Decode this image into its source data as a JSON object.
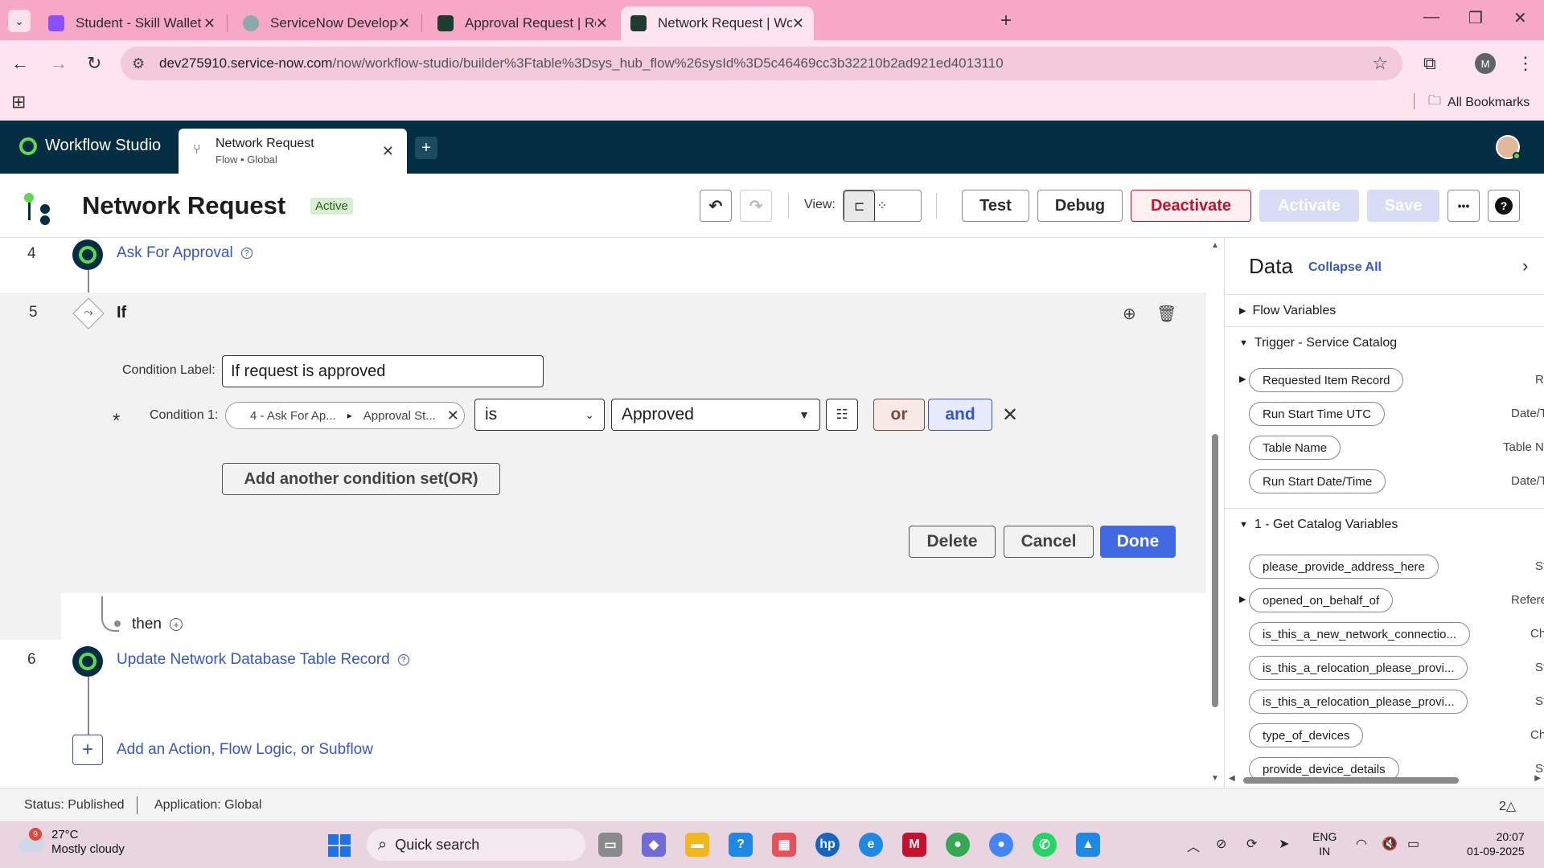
{
  "browser": {
    "tabs": [
      {
        "title": "Student - Skill Wallet",
        "color": "#8a4fff"
      },
      {
        "title": "ServiceNow Developers",
        "color": "#8aa9a8"
      },
      {
        "title": "Approval Request | Relationship",
        "color": "#1d3b2f"
      },
      {
        "title": "Network Request | Workflow St",
        "color": "#1d3b2f"
      }
    ],
    "url_host": "dev275910.service-now.com",
    "url_path": "/now/workflow-studio/builder%3Ftable%3Dsys_hub_flow%26sysId%3D5c46469cc3b32210b2ad921ed4013110",
    "profile_initial": "M",
    "bookmarks_label": "All Bookmarks"
  },
  "studio": {
    "app_name": "Workflow Studio",
    "tab_title": "Network Request",
    "tab_subtitle": "Flow • Global"
  },
  "flow": {
    "title": "Network Request",
    "status": "Active",
    "view_label": "View:",
    "buttons": {
      "test": "Test",
      "debug": "Debug",
      "deactivate": "Deactivate",
      "activate": "Activate",
      "save": "Save",
      "more": "•••",
      "help": "?"
    }
  },
  "canvas": {
    "steps": [
      {
        "num": "4",
        "label": "Ask For Approval"
      },
      {
        "num": "6",
        "label": "Update Network Database Table Record"
      }
    ],
    "if_block": {
      "num": "5",
      "title": "If",
      "condition_label_caption": "Condition Label:",
      "condition_label_value": "If request is approved",
      "asterisk": "*",
      "condition1_caption": "Condition 1:",
      "pill_part1": "4 - Ask For Ap...",
      "pill_part2": "Approval St...",
      "operator": "is",
      "value": "Approved",
      "or_label": "or",
      "and_label": "and",
      "add_set_label": "Add another condition set(OR)",
      "delete_label": "Delete",
      "cancel_label": "Cancel",
      "done_label": "Done"
    },
    "then_label": "then",
    "add_action_label": "Add an Action, Flow Logic, or Subflow"
  },
  "data_panel": {
    "title": "Data",
    "collapse_all": "Collapse All",
    "sections": [
      {
        "label": "Flow Variables",
        "expanded": false
      },
      {
        "label": "Trigger - Service Catalog",
        "expanded": true
      },
      {
        "label": "1 - Get Catalog Variables",
        "expanded": true
      }
    ],
    "trigger_items": [
      {
        "label": "Requested Item Record",
        "type": "Re",
        "expandable": true
      },
      {
        "label": "Run Start Time UTC",
        "type": "Date/T",
        "expandable": false
      },
      {
        "label": "Table Name",
        "type": "Table N",
        "expandable": false
      },
      {
        "label": "Run Start Date/Time",
        "type": "Date/T",
        "expandable": false
      }
    ],
    "catalog_items": [
      {
        "label": "please_provide_address_here",
        "type": "St",
        "expandable": false
      },
      {
        "label": "opened_on_behalf_of",
        "type": "Refere",
        "expandable": true
      },
      {
        "label": "is_this_a_new_network_connectio...",
        "type": "Ch",
        "expandable": false
      },
      {
        "label": "is_this_a_relocation_please_provi...",
        "type": "St",
        "expandable": false
      },
      {
        "label": "is_this_a_relocation_please_provi...",
        "type": "St",
        "expandable": false
      },
      {
        "label": "type_of_devices",
        "type": "Ch",
        "expandable": false
      },
      {
        "label": "provide_device_details",
        "type": "St",
        "expandable": false
      }
    ]
  },
  "statusbar": {
    "status": "Status: Published",
    "application": "Application: Global",
    "notifications": "2△"
  },
  "taskbar": {
    "weather_badge": "9",
    "temperature": "27°C",
    "weather_text": "Mostly cloudy",
    "search_placeholder": "Quick search",
    "lang_line1": "ENG",
    "lang_line2": "IN",
    "time": "20:07",
    "date": "01-09-2025"
  }
}
